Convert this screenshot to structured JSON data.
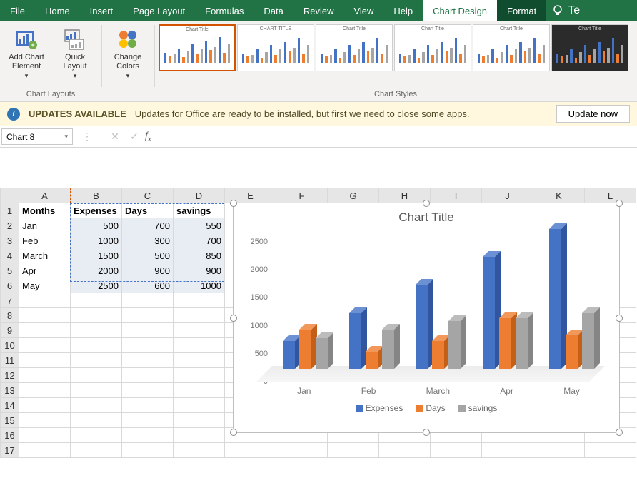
{
  "tabs": [
    "File",
    "Home",
    "Insert",
    "Page Layout",
    "Formulas",
    "Data",
    "Review",
    "View",
    "Help",
    "Chart Design",
    "Format"
  ],
  "active_tab": "Chart Design",
  "tell_me": "Te",
  "ribbon": {
    "add_chart_element": "Add Chart\nElement",
    "quick_layout": "Quick\nLayout",
    "change_colors": "Change\nColors",
    "group_layouts": "Chart Layouts",
    "group_styles": "Chart Styles"
  },
  "update": {
    "title": "UPDATES AVAILABLE",
    "message": "Updates for Office are ready to be installed, but first we need to close some apps.",
    "button": "Update now"
  },
  "namebox": "Chart 8",
  "formula": "",
  "columns": [
    "A",
    "B",
    "C",
    "D",
    "E",
    "F",
    "G",
    "H",
    "I",
    "J",
    "K",
    "L"
  ],
  "rows": 17,
  "table": {
    "headers": [
      "Months",
      "Expenses",
      "Days",
      "savings"
    ],
    "data": [
      [
        "Jan",
        500,
        700,
        550
      ],
      [
        "Feb",
        1000,
        300,
        700
      ],
      [
        "March",
        1500,
        500,
        850
      ],
      [
        "Apr",
        2000,
        900,
        900
      ],
      [
        "May",
        2500,
        600,
        1000
      ]
    ]
  },
  "chart_data": {
    "type": "bar",
    "title": "Chart Title",
    "categories": [
      "Jan",
      "Feb",
      "March",
      "Apr",
      "May"
    ],
    "series": [
      {
        "name": "Expenses",
        "values": [
          500,
          1000,
          1500,
          2000,
          2500
        ],
        "color": "#4472c4"
      },
      {
        "name": "Days",
        "values": [
          700,
          300,
          500,
          900,
          600
        ],
        "color": "#ed7d31"
      },
      {
        "name": "savings",
        "values": [
          550,
          700,
          850,
          900,
          1000
        ],
        "color": "#a5a5a5"
      }
    ],
    "ylim": [
      0,
      2500
    ],
    "ystep": 500,
    "xlabel": "",
    "ylabel": ""
  }
}
